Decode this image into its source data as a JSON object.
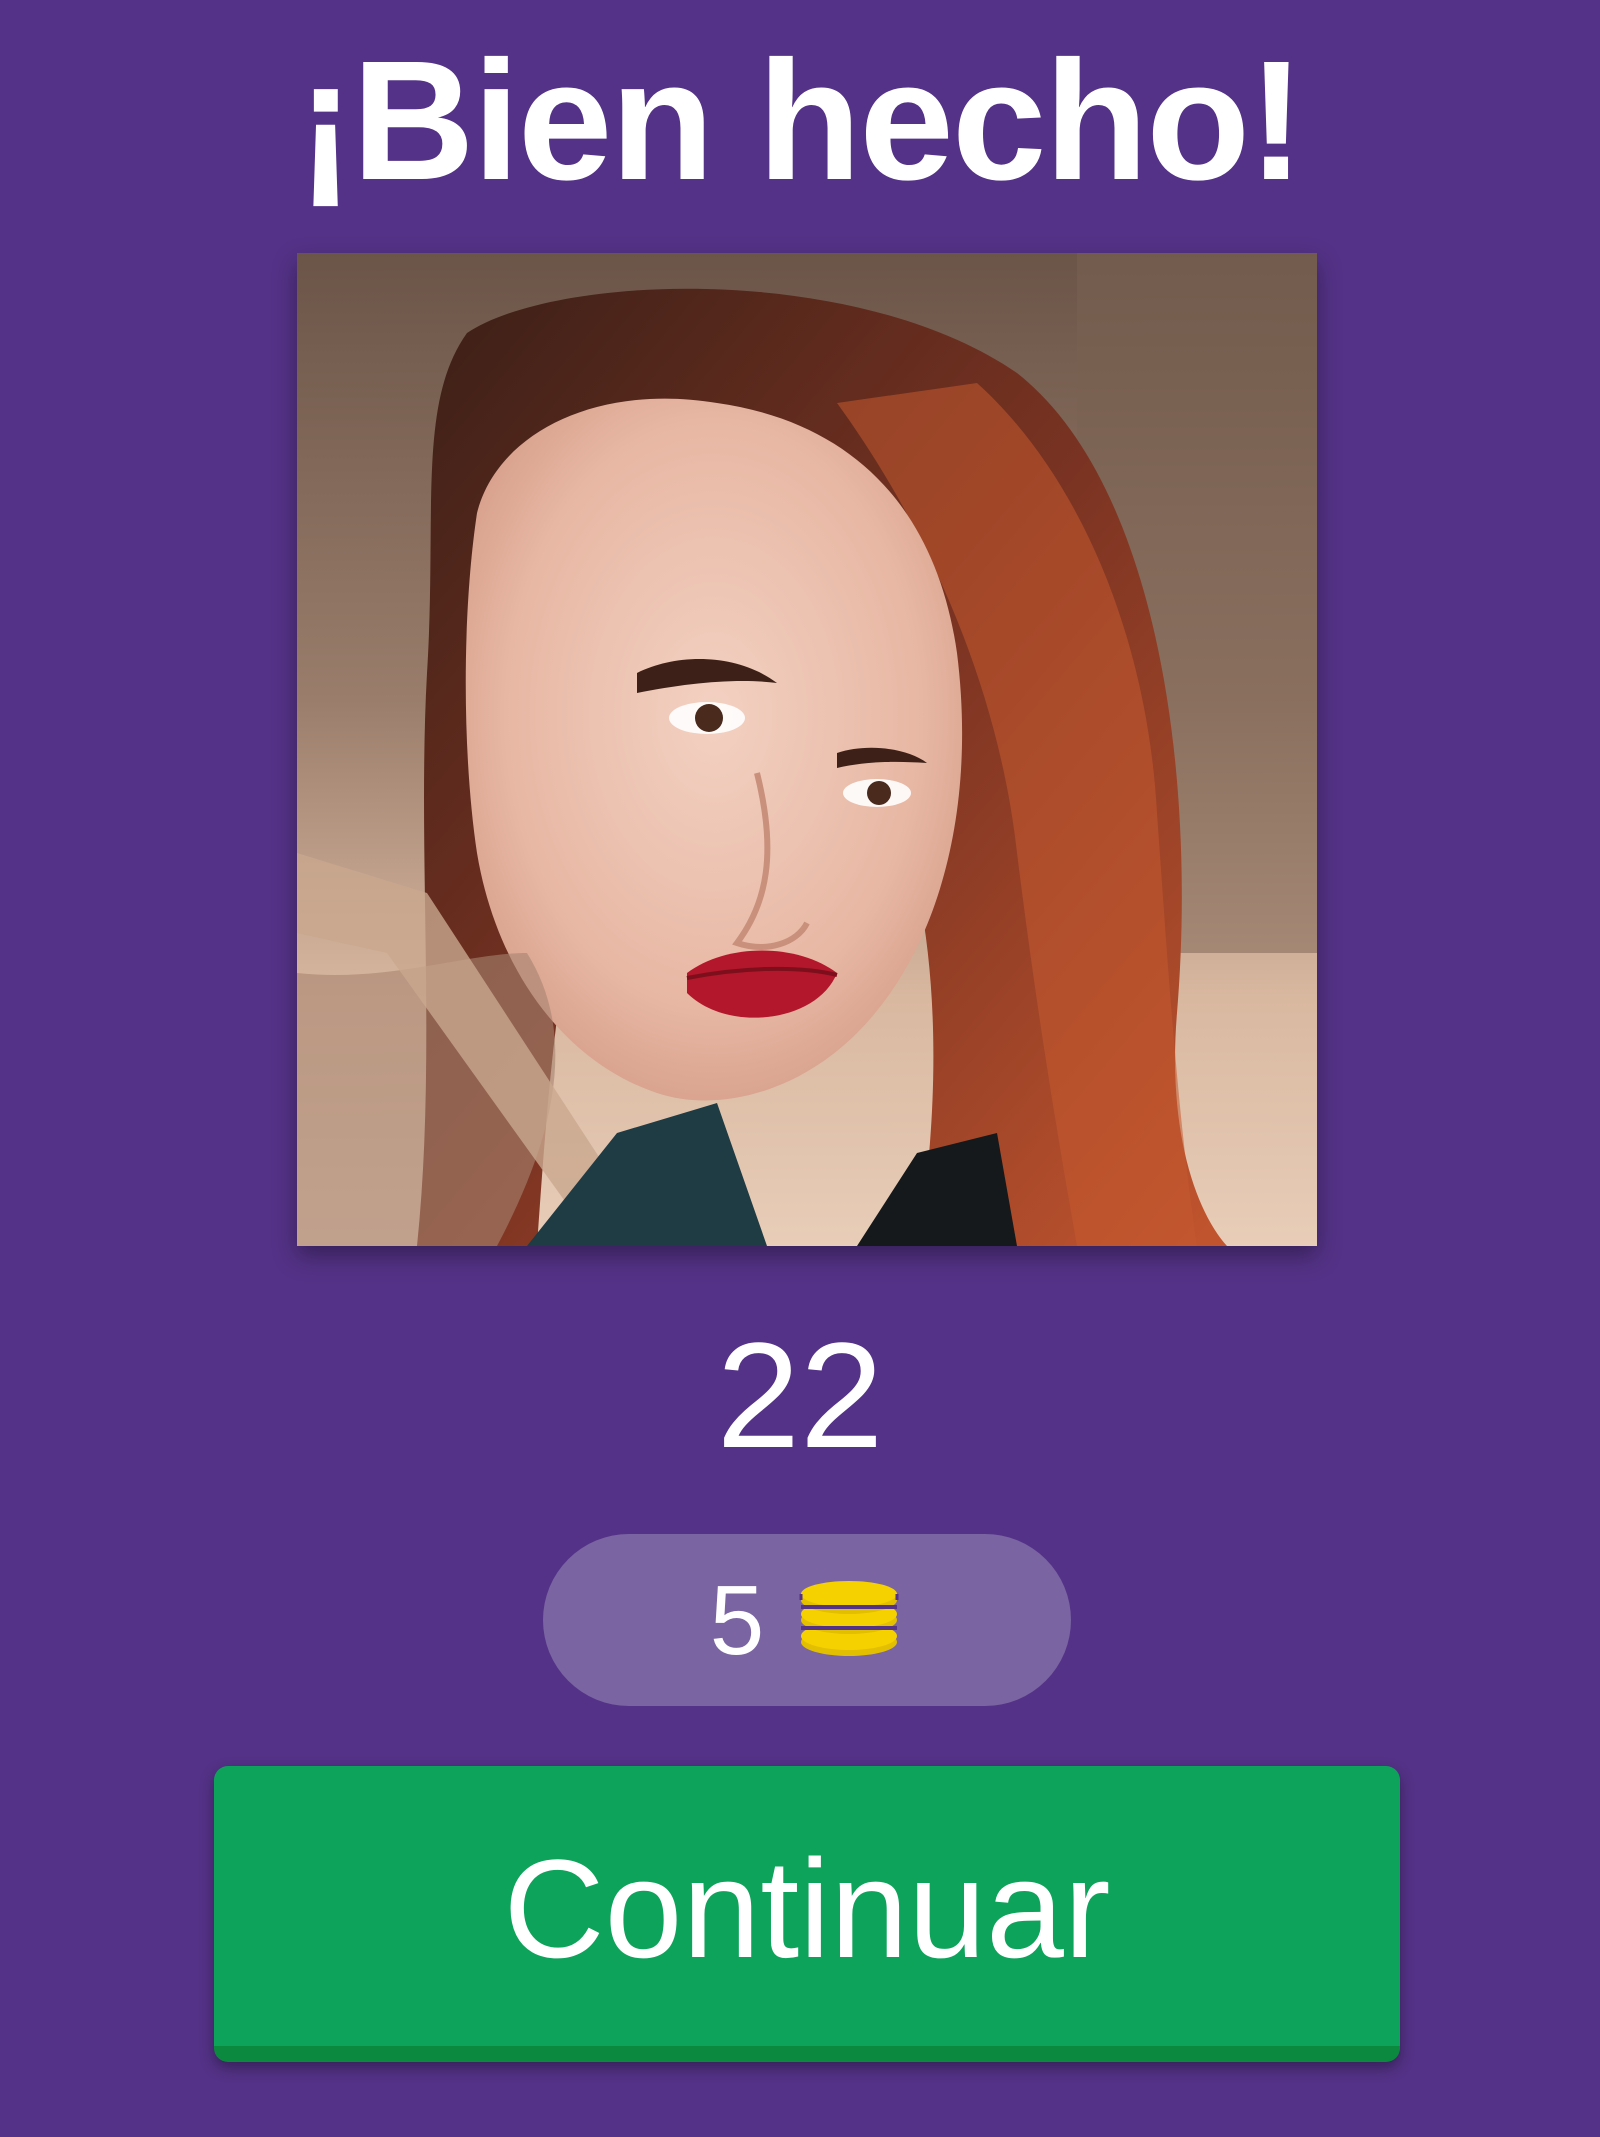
{
  "header": {
    "title": "¡Bien hecho!"
  },
  "question": {
    "image_alt": "portrait photo"
  },
  "result": {
    "level_number": "22",
    "reward_coins": "5",
    "coin_icon": "coins-stack-icon"
  },
  "actions": {
    "continue_label": "Continuar"
  },
  "colors": {
    "background": "#543287",
    "pill": "#7a64a2",
    "button": "#0ea35a",
    "button_shadow": "#0b8a3f",
    "coin": "#f6d100"
  }
}
